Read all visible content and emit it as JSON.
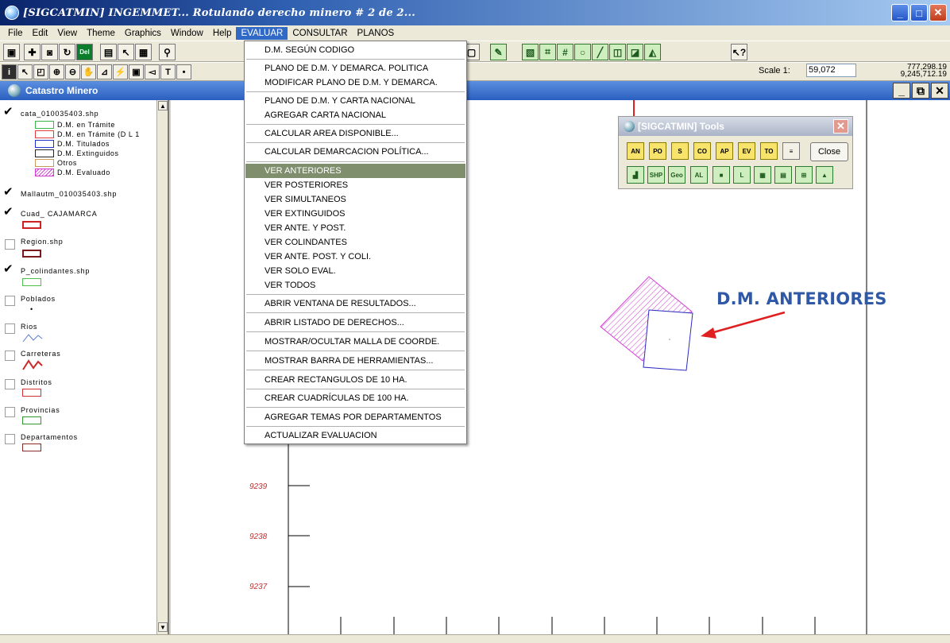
{
  "window": {
    "title": "[SIGCATMIN] INGEMMET... Rotulando derecho minero # 2 de 2...",
    "minimize": "_",
    "maximize": "□",
    "close": "✕"
  },
  "menubar": {
    "items": [
      "File",
      "Edit",
      "View",
      "Theme",
      "Graphics",
      "Window",
      "Help",
      "EVALUAR",
      "CONSULTAR",
      "PLANOS"
    ],
    "active": "EVALUAR"
  },
  "toolbar": {
    "scale_label": "Scale 1:",
    "scale_value": "59,072",
    "coord_x": "777,298.19",
    "coord_y": "9,245,712.19",
    "del_label": "Del"
  },
  "document": {
    "title": "Catastro Minero"
  },
  "legend": {
    "layers": [
      {
        "name": "cata_010035403.shp",
        "checked": true
      },
      {
        "name": "Mallautm_010035403.shp",
        "checked": true
      },
      {
        "name": "Cuad_ CAJAMARCA",
        "checked": true
      },
      {
        "name": "Region.shp",
        "checked": false
      },
      {
        "name": "P_colindantes.shp",
        "checked": true
      },
      {
        "name": "Poblados",
        "checked": false
      },
      {
        "name": "Rios",
        "checked": false
      },
      {
        "name": "Carreteras",
        "checked": false
      },
      {
        "name": "Distritos",
        "checked": false
      },
      {
        "name": "Provincias",
        "checked": false
      },
      {
        "name": "Departamentos",
        "checked": false
      }
    ],
    "cata_classes": [
      "D.M. en Trámite",
      "D.M. en Trámite (D L 1",
      "D.M. Titulados",
      "D.M. Extinguidos",
      "Otros",
      "D.M. Evaluado"
    ],
    "colors": {
      "tramite": "#39b54a",
      "tramite_dl": "#e03c3c",
      "titulados": "#2233cc",
      "extinguidos": "#222222",
      "otros": "#c89a5a",
      "evaluado": "#d23bd2",
      "cuad": "#cc2222",
      "region": "#7a1a1a",
      "colindantes": "#4cc24c",
      "carreteras": "#cc2a2a",
      "rios": "#5a7ad0"
    }
  },
  "evaluar_menu": {
    "groups": [
      [
        "D.M. SEGÚN CODIGO"
      ],
      [
        "PLANO DE D.M. Y DEMARCA. POLITICA",
        "MODIFICAR PLANO DE D.M. Y DEMARCA."
      ],
      [
        "PLANO DE D.M. Y CARTA NACIONAL",
        "AGREGAR CARTA NACIONAL"
      ],
      [
        "CALCULAR AREA DISPONIBLE..."
      ],
      [
        "CALCULAR DEMARCACION POLÍTICA..."
      ],
      [
        "VER ANTERIORES",
        "VER POSTERIORES",
        "VER SIMULTANEOS",
        "VER EXTINGUIDOS",
        "VER ANTE. Y POST.",
        "VER COLINDANTES",
        "VER ANTE. POST. Y COLI.",
        "VER SOLO EVAL.",
        "VER TODOS"
      ],
      [
        "ABRIR VENTANA DE RESULTADOS..."
      ],
      [
        "ABRIR LISTADO DE DERECHOS..."
      ],
      [
        "MOSTRAR/OCULTAR MALLA DE COORDE."
      ],
      [
        "MOSTRAR BARRA DE HERRAMIENTAS..."
      ],
      [
        "CREAR RECTANGULOS DE 10 HA."
      ],
      [
        "CREAR CUADRÍCULAS DE 100 HA."
      ],
      [
        "AGREGAR TEMAS POR DEPARTAMENTOS"
      ],
      [
        "ACTUALIZAR EVALUACION"
      ]
    ],
    "highlighted": "VER ANTERIORES"
  },
  "tools_window": {
    "title": "[SIGCATMIN] Tools",
    "row1": [
      "AN",
      "PO",
      "S",
      "CO",
      "AP",
      "EV",
      "TO",
      "≡"
    ],
    "row2": [
      "",
      "SHP",
      "Geo",
      "AL",
      "■",
      "L",
      "▦",
      "▤",
      "⊞",
      "▲"
    ],
    "close_label": "Close"
  },
  "map": {
    "y_labels": [
      "9239",
      "9238",
      "9237"
    ],
    "annotation": "D.M. ANTERIORES"
  }
}
